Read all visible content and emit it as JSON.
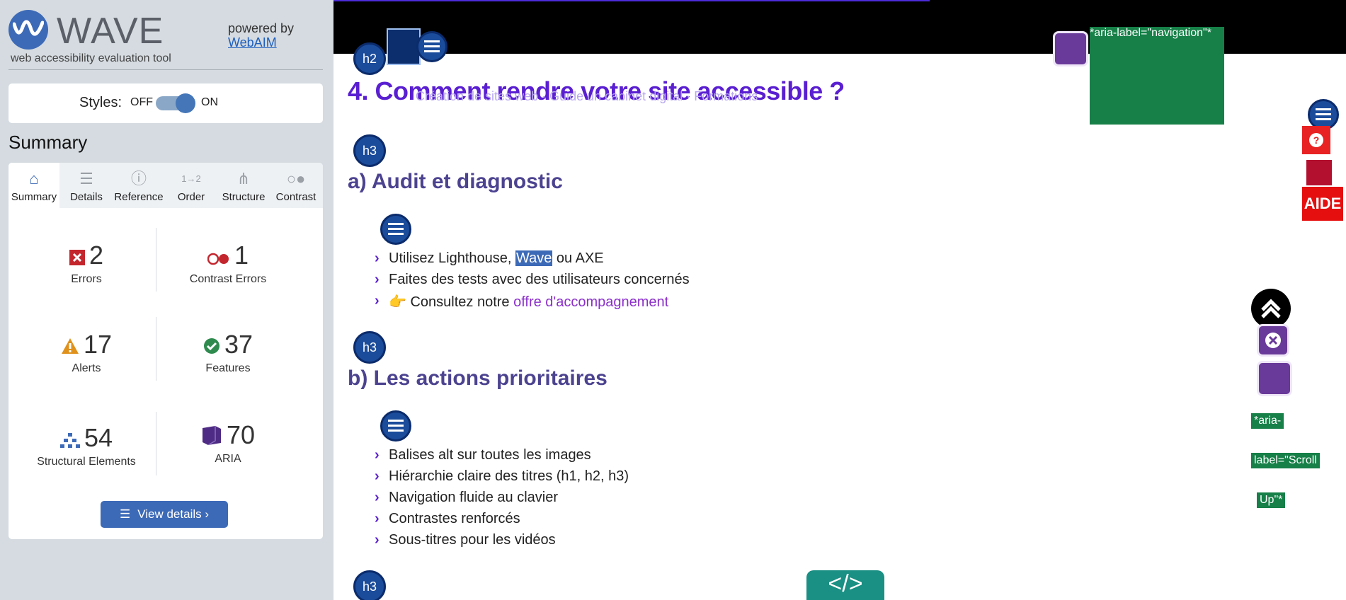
{
  "sidebar": {
    "logo_text": "WAVE",
    "tagline": "web accessibility evaluation tool",
    "powered_by": "powered by",
    "powered_link": "WebAIM",
    "styles": {
      "label": "Styles:",
      "off": "OFF",
      "on": "ON",
      "state": "on"
    },
    "summary_title": "Summary",
    "tabs": [
      {
        "label": "Summary",
        "icon": "home-icon"
      },
      {
        "label": "Details",
        "icon": "list-icon"
      },
      {
        "label": "Reference",
        "icon": "info-icon"
      },
      {
        "label": "Order",
        "icon": "order-icon"
      },
      {
        "label": "Structure",
        "icon": "structure-icon"
      },
      {
        "label": "Contrast",
        "icon": "contrast-icon"
      }
    ],
    "stats": {
      "errors": {
        "count": "2",
        "label": "Errors"
      },
      "contrast_errors": {
        "count": "1",
        "label": "Contrast Errors"
      },
      "alerts": {
        "count": "17",
        "label": "Alerts"
      },
      "features": {
        "count": "37",
        "label": "Features"
      },
      "structural": {
        "count": "54",
        "label": "Structural Elements"
      },
      "aria": {
        "count": "70",
        "label": "ARIA"
      }
    },
    "view_details": "View details ›"
  },
  "page": {
    "aria_label_nav": "*aria-label=\"navigation\"*",
    "markers": {
      "h2": "h2",
      "h3": "h3"
    },
    "heading_main": "4. Comment rendre votre site accessible ?",
    "overlay_text": "Création de sites web · Guide un cabinet digital · Formations",
    "section_a": {
      "title": "a) Audit et diagnostic",
      "items": [
        {
          "pre": "Utilisez Lighthouse, ",
          "highlight": "Wave",
          "post": " ou AXE"
        },
        {
          "text": "Faites des tests avec des utilisateurs concernés"
        },
        {
          "pre": "👉 Consultez notre ",
          "link": "offre d'accompagnement"
        }
      ]
    },
    "section_b": {
      "title": "b) Les actions prioritaires",
      "items": [
        "Balises alt sur toutes les images",
        "Hiérarchie claire des titres (h1, h2, h3)",
        "Navigation fluide au clavier",
        "Contrastes renforcés",
        "Sous-titres pour les vidéos"
      ]
    },
    "aide_label": "AIDE",
    "aria_scroll": [
      "*aria-",
      "label=\"Scroll",
      "Up\"*"
    ],
    "help_glyph": "?",
    "code_glyph": "</>"
  }
}
